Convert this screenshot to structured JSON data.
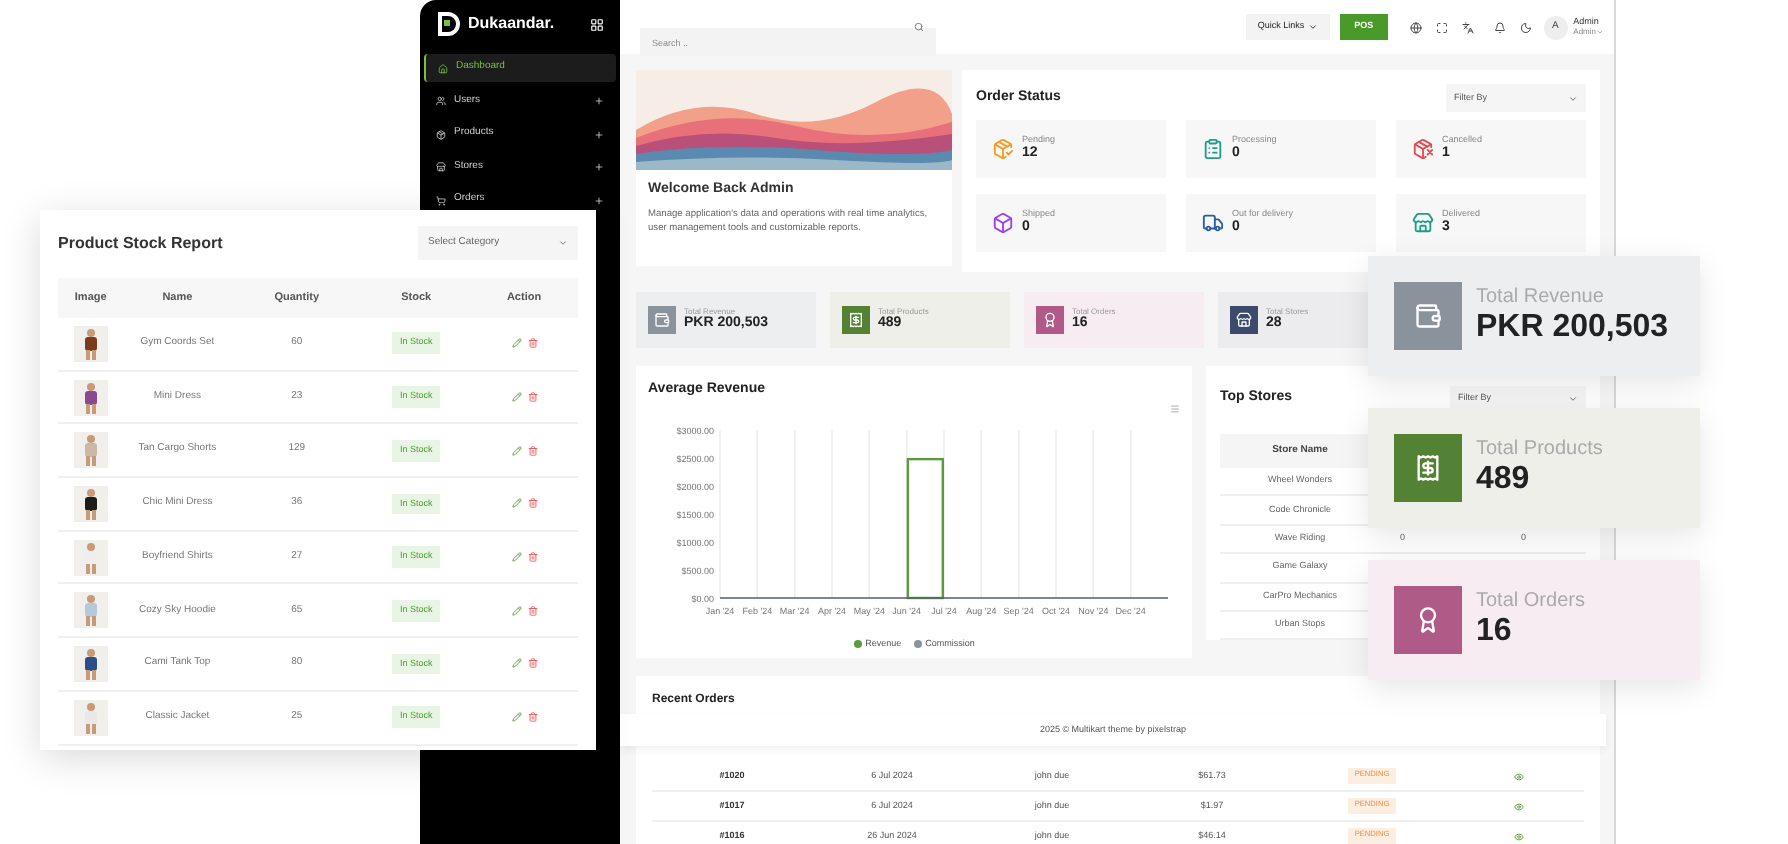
{
  "sidebar": {
    "brand": "Dukaandar.",
    "items": [
      {
        "label": "Dashboard",
        "selected": true,
        "expandable": false,
        "kind": "home"
      },
      {
        "label": "Users",
        "selected": false,
        "expandable": true,
        "kind": "users"
      },
      {
        "label": "Products",
        "selected": false,
        "expandable": true,
        "kind": "products"
      },
      {
        "label": "Stores",
        "selected": false,
        "expandable": true,
        "kind": "stores"
      },
      {
        "label": "Orders",
        "selected": false,
        "expandable": true,
        "kind": "orders"
      }
    ]
  },
  "header": {
    "search": {
      "placeholder": "Search .."
    },
    "quick_links": "Quick Links",
    "pos": "POS",
    "avatar": "A",
    "user_name": "Admin",
    "user_role": "Admin"
  },
  "welcome": {
    "title": "Welcome Back Admin",
    "text": "Manage application's data and operations with real time analytics, user management tools and customizable reports."
  },
  "order_status": {
    "title": "Order Status",
    "filter": "Filter By",
    "tiles": [
      {
        "label": "Pending",
        "value": "12",
        "color": "#f59a23",
        "kind": "pending"
      },
      {
        "label": "Processing",
        "value": "0",
        "color": "#1f9e84",
        "kind": "processing"
      },
      {
        "label": "Cancelled",
        "value": "1",
        "color": "#e5484d",
        "kind": "cancelled"
      },
      {
        "label": "Shipped",
        "value": "0",
        "color": "#9b3ff5",
        "kind": "shipped"
      },
      {
        "label": "Out for delivery",
        "value": "0",
        "color": "#2b5d9e",
        "kind": "delivery"
      },
      {
        "label": "Delivered",
        "value": "3",
        "color": "#1f9e84",
        "kind": "delivered"
      }
    ]
  },
  "stats": [
    {
      "label": "Total Revenue",
      "value": "PKR 200,503",
      "color": "#8a929c",
      "kind": "revenue"
    },
    {
      "label": "Total Products",
      "value": "489",
      "color": "#548235",
      "kind": "products"
    },
    {
      "label": "Total Orders",
      "value": "16",
      "color": "#b05a87",
      "kind": "orders"
    },
    {
      "label": "Total Stores",
      "value": "28",
      "color": "#3d4a6b",
      "kind": "stores"
    }
  ],
  "average_revenue": {
    "title": "Average Revenue",
    "chart_data": {
      "type": "bar",
      "categories": [
        "Jan '24",
        "Feb '24",
        "Mar '24",
        "Apr '24",
        "May '24",
        "Jun '24",
        "Jul '24",
        "Aug '24",
        "Sep '24",
        "Oct '24",
        "Nov '24",
        "Dec '24"
      ],
      "series": [
        {
          "name": "Revenue",
          "color": "#5b9b3c",
          "values": [
            0,
            0,
            0,
            0,
            0,
            2480,
            0,
            0,
            0,
            0,
            0,
            0
          ]
        },
        {
          "name": "Commission",
          "color": "#8a929c",
          "values": [
            0,
            0,
            0,
            0,
            0,
            0,
            0,
            0,
            0,
            0,
            0,
            0
          ]
        }
      ],
      "ylim": [
        0,
        3000
      ],
      "grid": true,
      "yticks": [
        {
          "value": 0,
          "label": "$0.00"
        },
        {
          "value": 500,
          "label": "$500.00"
        },
        {
          "value": 1000,
          "label": "$1000.00"
        },
        {
          "value": 1500,
          "label": "$1500.00"
        },
        {
          "value": 2000,
          "label": "$2000.00"
        },
        {
          "value": 2500,
          "label": "$2500.00"
        },
        {
          "value": 3000,
          "label": "$3000.00"
        }
      ]
    }
  },
  "top_stores": {
    "title": "Top Stores",
    "filter": "Filter By",
    "column": "Store Name",
    "rows": [
      {
        "name": "Wheel Wonders"
      },
      {
        "name": "Code Chronicle"
      },
      {
        "name": "Wave Riding",
        "column_2": "0",
        "column_3": "0"
      },
      {
        "name": "Game Galaxy"
      },
      {
        "name": "CarPro Mechanics"
      },
      {
        "name": "Urban Stops"
      }
    ]
  },
  "recent_orders": {
    "title": "Recent Orders",
    "rows": [
      {
        "id": "#1020",
        "date": "6 Jul 2024",
        "customer": "john due",
        "amount": "$61.73",
        "status": "PENDING"
      },
      {
        "id": "#1017",
        "date": "6 Jul 2024",
        "customer": "john due",
        "amount": "$1.97",
        "status": "PENDING"
      },
      {
        "id": "#1016",
        "date": "26 Jun 2024",
        "customer": "john due",
        "amount": "$46.14",
        "status": "PENDING"
      }
    ]
  },
  "footer": "2025 © Multikart theme by pixelstrap",
  "stock_report": {
    "title": "Product Stock Report",
    "select": "Select Category",
    "columns": [
      "Image",
      "Name",
      "Quantity",
      "Stock",
      "Action"
    ],
    "rows": [
      {
        "name": "Gym Coords Set",
        "quantity": "60",
        "stock": "In Stock"
      },
      {
        "name": "Mini Dress",
        "quantity": "23",
        "stock": "In Stock"
      },
      {
        "name": "Tan Cargo Shorts",
        "quantity": "129",
        "stock": "In Stock"
      },
      {
        "name": "Chic Mini Dress",
        "quantity": "36",
        "stock": "In Stock"
      },
      {
        "name": "Boyfriend Shirts",
        "quantity": "27",
        "stock": "In Stock"
      },
      {
        "name": "Cozy Sky Hoodie",
        "quantity": "65",
        "stock": "In Stock"
      },
      {
        "name": "Cami Tank Top",
        "quantity": "80",
        "stock": "In Stock"
      },
      {
        "name": "Classic Jacket",
        "quantity": "25",
        "stock": "In Stock"
      }
    ]
  },
  "highlight_cards": [
    {
      "label": "Total Revenue",
      "value": "PKR 200,503",
      "color": "#8a929c",
      "kind": "revenue"
    },
    {
      "label": "Total Products",
      "value": "489",
      "color": "#548235",
      "kind": "products"
    },
    {
      "label": "Total Orders",
      "value": "16",
      "color": "#b05a87",
      "kind": "orders"
    }
  ]
}
